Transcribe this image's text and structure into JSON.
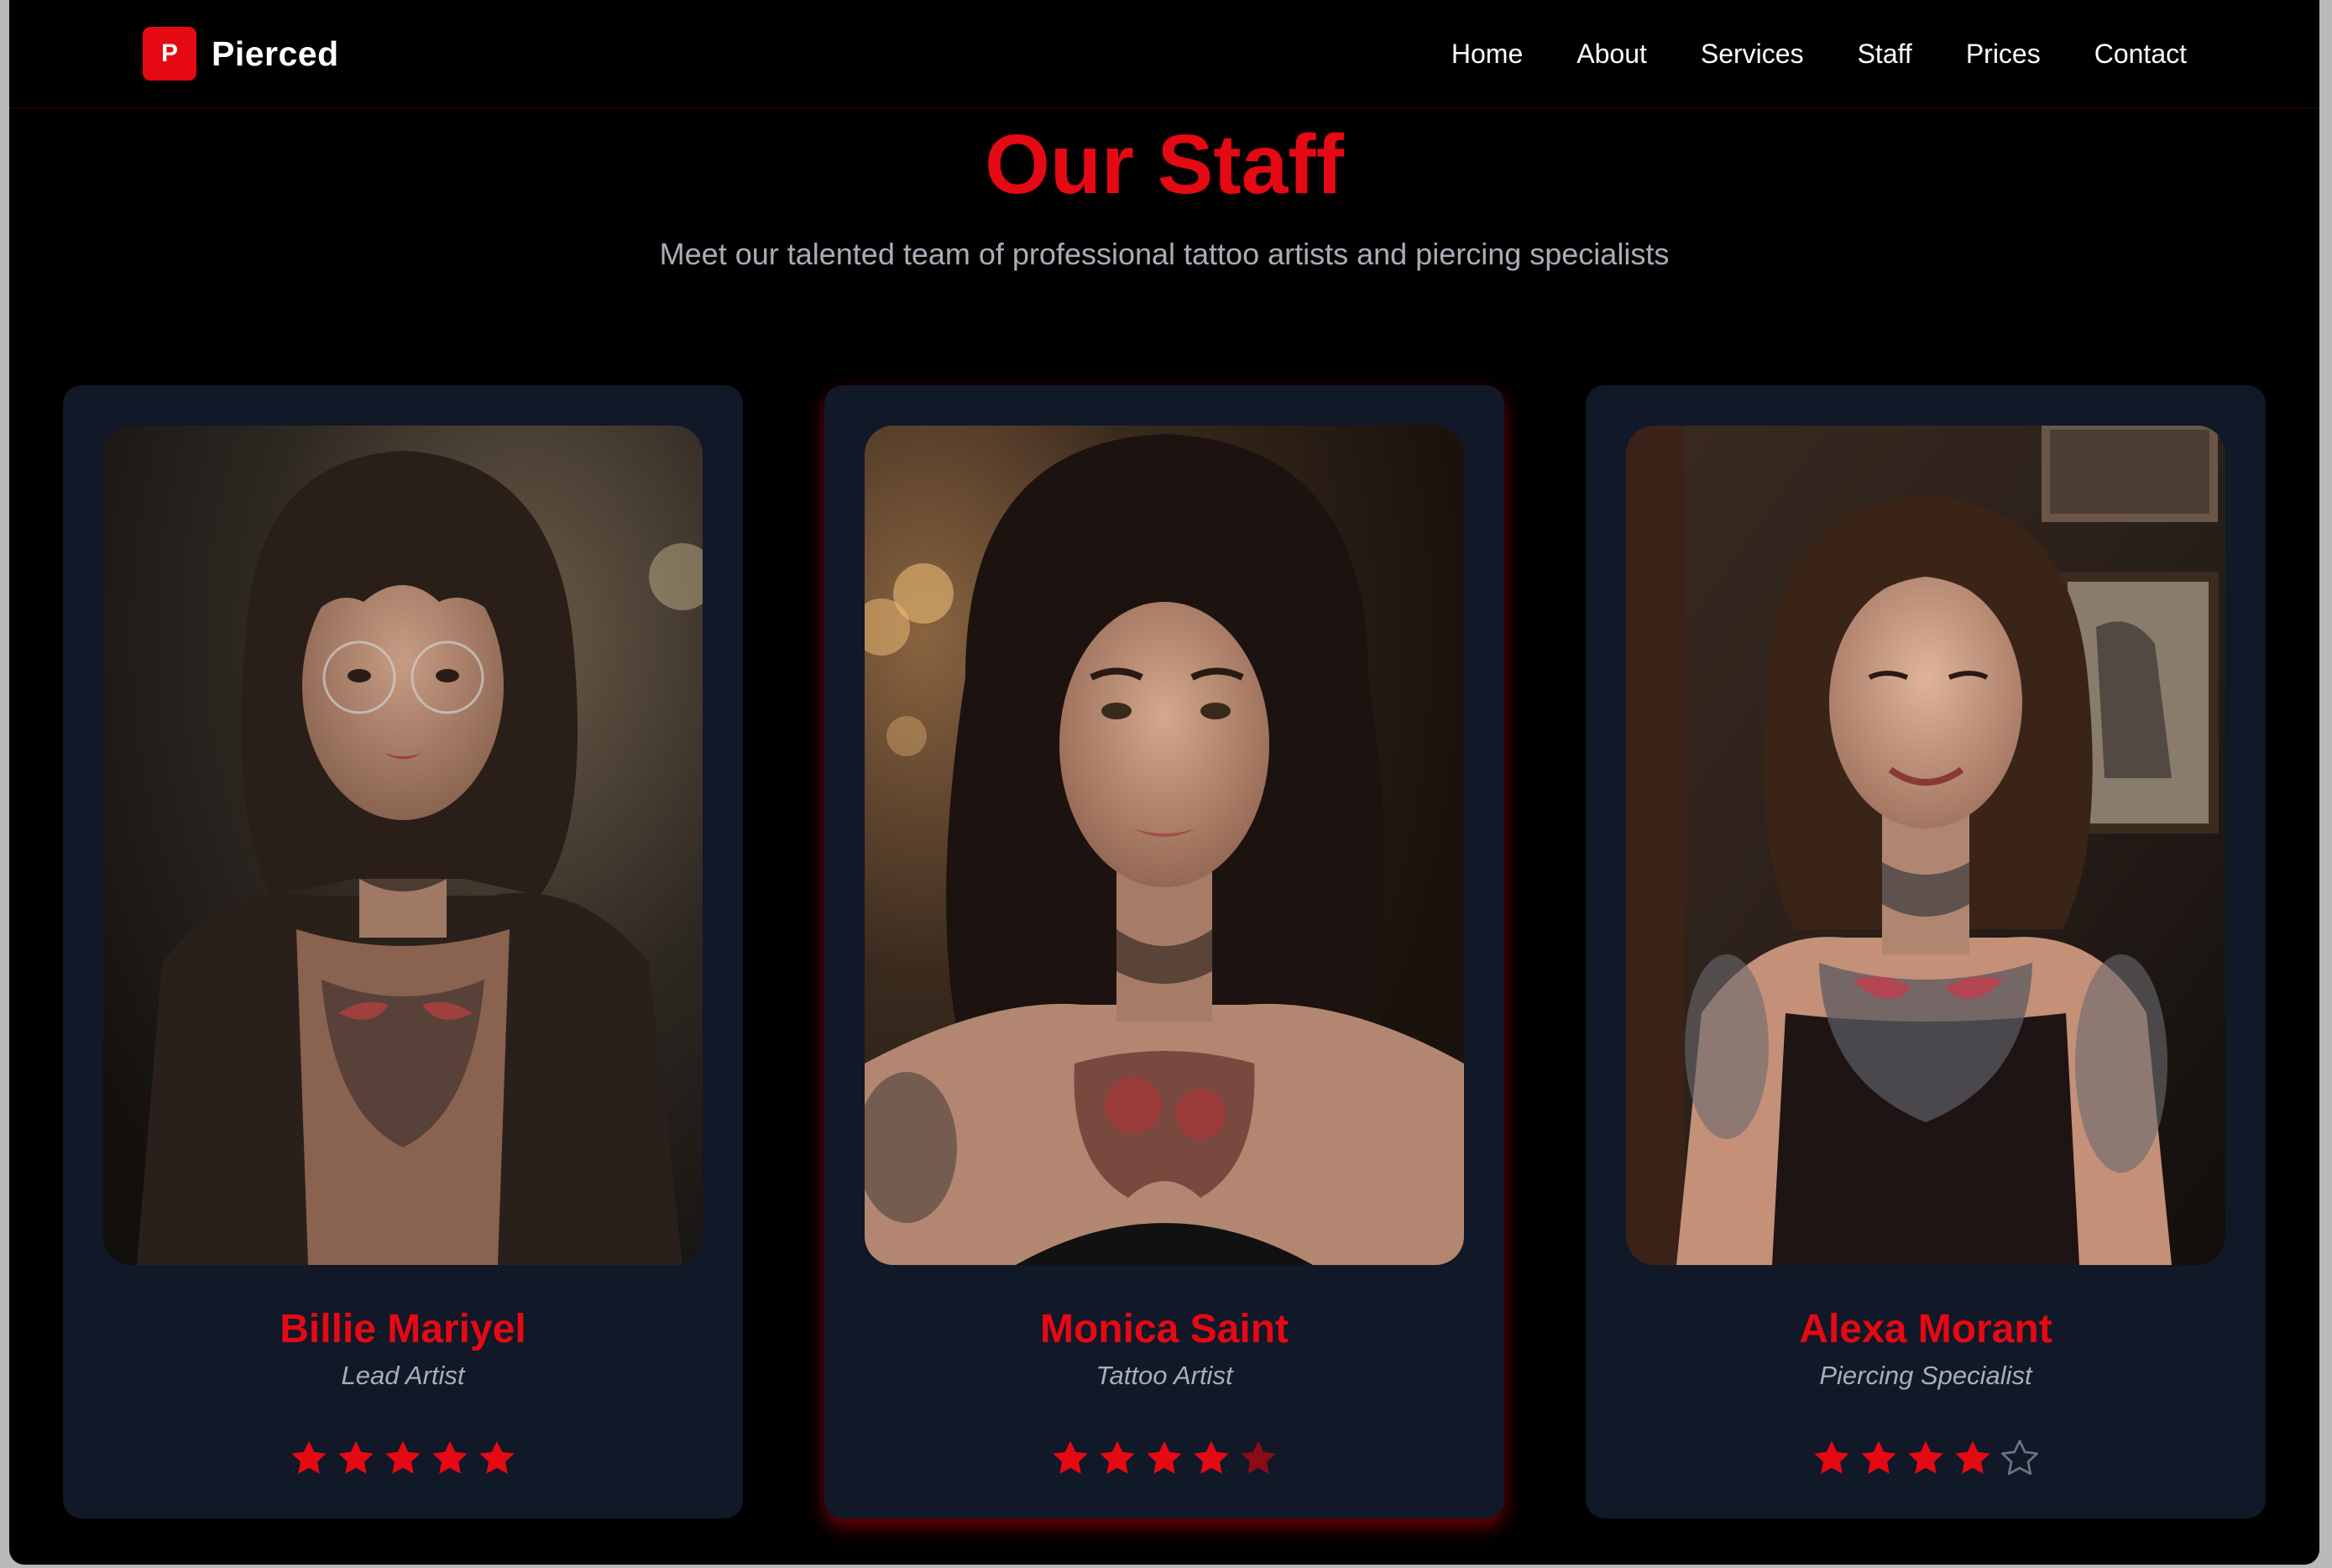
{
  "colors": {
    "accent": "#e50914",
    "background": "#000000",
    "card": "#111827",
    "muted_text": "#a8adb7",
    "star_half": "#8a0c14",
    "star_empty": "#6b7280"
  },
  "brand": {
    "logo_letter": "P",
    "name": "Pierced"
  },
  "nav": {
    "items": [
      {
        "label": "Home"
      },
      {
        "label": "About"
      },
      {
        "label": "Services"
      },
      {
        "label": "Staff"
      },
      {
        "label": "Prices"
      },
      {
        "label": "Contact"
      }
    ]
  },
  "header": {
    "title": "Our Staff",
    "subtitle": "Meet our talented team of professional tattoo artists and piercing specialists"
  },
  "staff": [
    {
      "name": "Billie Mariyel",
      "role": "Lead Artist",
      "rating": 5,
      "stars": [
        "full",
        "full",
        "full",
        "full",
        "full"
      ]
    },
    {
      "name": "Monica Saint",
      "role": "Tattoo Artist",
      "rating": 4.5,
      "stars": [
        "full",
        "full",
        "full",
        "full",
        "half"
      ]
    },
    {
      "name": "Alexa Morant",
      "role": "Piercing Specialist",
      "rating": 4,
      "stars": [
        "full",
        "full",
        "full",
        "full",
        "empty"
      ]
    }
  ]
}
